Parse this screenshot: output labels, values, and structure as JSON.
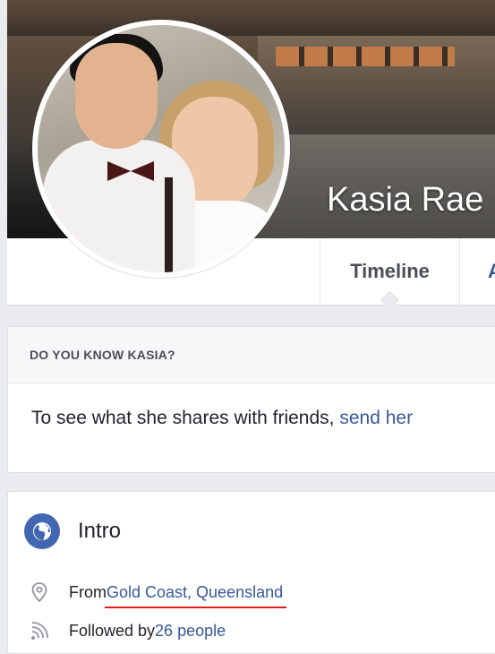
{
  "profile": {
    "name": "Kasia Rae"
  },
  "nav": {
    "tab_timeline": "Timeline",
    "tab_next_partial": "A"
  },
  "know_card": {
    "header": "DO YOU KNOW KASIA?",
    "text": "To see what she shares with friends, ",
    "link": "send her"
  },
  "intro": {
    "title": "Intro",
    "from_label": "From ",
    "hometown": "Gold Coast, Queensland",
    "followed_label": "Followed by ",
    "followers": "26 people",
    "icons": [
      "globe-icon",
      "location-pin-icon",
      "rss-icon"
    ]
  },
  "colors": {
    "link": "#365899",
    "accent": "#4267b2",
    "underline": "#e0201f",
    "page_bg": "#e9ebee"
  }
}
